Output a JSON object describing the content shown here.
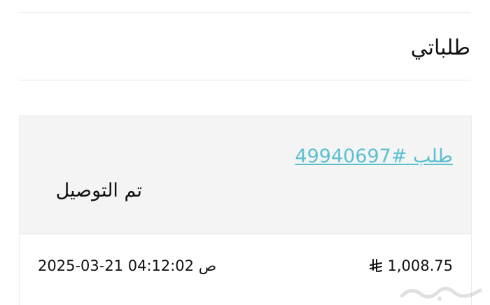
{
  "page": {
    "title": "طلباتي"
  },
  "order": {
    "link_label": "طلب #49940697",
    "status": "تم التوصيل",
    "amount": "1,008.75",
    "currency_icon": "saudi-riyal-icon",
    "datetime": "2025-03-21 04:12:02 ص"
  },
  "watermark": {
    "label": "حراج",
    "icon": "haraj-logo"
  },
  "colors": {
    "link": "#5bc0cf",
    "card_header": "#f4f4f4",
    "divider": "#e6e6e6"
  }
}
